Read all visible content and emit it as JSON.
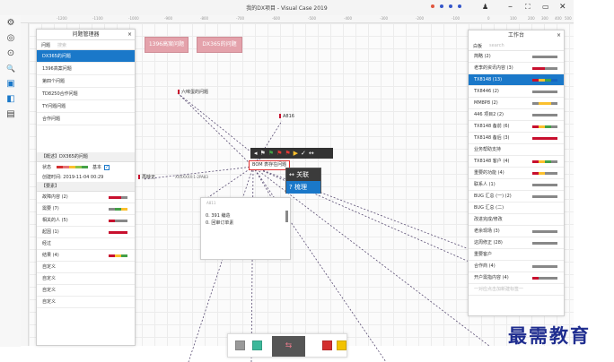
{
  "window": {
    "title": "我的DX项目 - Visual Case 2019",
    "status_dots": [
      "#e0563f",
      "#3556c9",
      "#3556c9",
      "#3556c9"
    ],
    "controls": {
      "user": "♟",
      "minimize": "–",
      "maximize": "⛶",
      "restore": "▭",
      "close": "✕"
    }
  },
  "left_toolbar": {
    "icons": [
      "gear-icon",
      "compass-icon",
      "target-icon",
      "search-icon",
      "layers-icon",
      "folder-icon",
      "chart-icon"
    ],
    "glyphs": [
      "⚙",
      "◎",
      "⊙",
      "🔍",
      "▣",
      "◧",
      "▤"
    ]
  },
  "ruler": {
    "ticks": [
      "-1200",
      "-1100",
      "-1000",
      "-900",
      "-800",
      "-700",
      "-600",
      "-500",
      "-400",
      "-300",
      "-200",
      "-100",
      "0",
      "100",
      "200",
      "300",
      "400",
      "500"
    ]
  },
  "problem_panel": {
    "title": "问题管理器",
    "close": "×",
    "tabs": [
      "问题",
      "搜索"
    ],
    "items": [
      "DX365的问题",
      "1396高案问题",
      "第四个问题",
      "TD8250合作问题",
      "TY问题问题",
      "合作问题"
    ],
    "selected_index": 0,
    "info_header": "【概述】DX365的问题",
    "status_label": "状态",
    "status_bars": [
      "#d32f2f",
      "#e57373",
      "#fbc02d",
      "#8bc34a",
      "#43a047"
    ],
    "basic_label": "基本",
    "created_label": "创建时间: 2019-11-04 00:29",
    "tags_header": "【要素】",
    "tags": [
      {
        "label": "故障内容 (2)",
        "bars": [
          "#c8102e",
          "#c8102e",
          "#888"
        ]
      },
      {
        "label": "需要 (7)",
        "bars": [
          "#888",
          "#43a047",
          "#fbc02d"
        ]
      },
      {
        "label": "相关的人 (5)",
        "bars": [
          "#c8102e",
          "#888",
          "#888"
        ]
      },
      {
        "label": "起因 (1)",
        "bars": [
          "#c8102e",
          "#c8102e",
          "#c8102e"
        ]
      },
      {
        "label": "经过",
        "bars": []
      },
      {
        "label": "结果 (4)",
        "bars": [
          "#c8102e",
          "#fbc02d",
          "#43a047"
        ]
      },
      {
        "label": "自定义",
        "bars": []
      },
      {
        "label": "自定义",
        "bars": []
      },
      {
        "label": "自定义",
        "bars": []
      },
      {
        "label": "自定义",
        "bars": []
      }
    ]
  },
  "canvas": {
    "chips": [
      "1396高案问题",
      "DX365的问题"
    ],
    "nodes": {
      "n1": "六味蛋的问题",
      "n2": "A816",
      "n3": "再映无",
      "n4": "XXXXXXX-1-2PA83",
      "n5": "BOM 表存在问题"
    },
    "node_toolbar": [
      "◂",
      "⚑",
      "⚑",
      "⚑",
      "⚑",
      "▶",
      "✓",
      "↔"
    ],
    "context_menu": [
      {
        "icon": "↔",
        "label": "关联"
      },
      {
        "icon": "?",
        "label": "梳理"
      }
    ],
    "context_selected": 1,
    "note": {
      "title": "A811",
      "lines": [
        "0. 391 编造",
        "0. 回审订单素"
      ]
    }
  },
  "workbench": {
    "title": "工作台",
    "close": "×",
    "tabs": [
      "白板",
      "search"
    ],
    "rows": [
      {
        "label": "简略 (2)",
        "bars": [
          "#888",
          "#888",
          "#888",
          "#888"
        ]
      },
      {
        "label": "老李的资讯内容 (3)",
        "bars": [
          "#c8102e",
          "#c8102e",
          "#888",
          "#888"
        ]
      },
      {
        "label": "TX8148 (13)",
        "bars": [
          "#c8102e",
          "#fbc02d",
          "#43a047",
          "#1565c0"
        ]
      },
      {
        "label": "TX8446 (2)",
        "bars": [
          "#888",
          "#888",
          "#888",
          "#888"
        ]
      },
      {
        "label": "MM8P8 (2)",
        "bars": [
          "#888",
          "#fbc02d",
          "#fbc02d",
          "#888"
        ]
      },
      {
        "label": "446 项目2 (2)",
        "bars": [
          "#888",
          "#888",
          "#888",
          "#888"
        ]
      },
      {
        "label": "TX8148 备前 (6)",
        "bars": [
          "#c8102e",
          "#fbc02d",
          "#43a047",
          "#888"
        ]
      },
      {
        "label": "TX8148 备后 (3)",
        "bars": [
          "#c8102e",
          "#c8102e",
          "#c8102e",
          "#c8102e"
        ]
      },
      {
        "label": "业务帮助支持",
        "bars": []
      },
      {
        "label": "TX8148 客户 (4)",
        "bars": [
          "#c8102e",
          "#fbc02d",
          "#43a047",
          "#888"
        ]
      },
      {
        "label": "重要的功能 (4)",
        "bars": [
          "#c8102e",
          "#fbc02d",
          "#888",
          "#888"
        ]
      },
      {
        "label": "联系人 (1)",
        "bars": [
          "#888",
          "#888",
          "#888",
          "#888"
        ]
      },
      {
        "label": "BUG 汇总 (一) (2)",
        "bars": [
          "#888",
          "#888",
          "#888",
          "#888"
        ]
      },
      {
        "label": "BUG 汇总 (二)",
        "bars": []
      },
      {
        "label": "改进完成/修改",
        "bars": []
      },
      {
        "label": "老余现场 (3)",
        "bars": [
          "#888",
          "#888",
          "#888",
          "#888"
        ]
      },
      {
        "label": "这周修正 (28)",
        "bars": [
          "#888",
          "#888",
          "#888",
          "#888"
        ]
      },
      {
        "label": "重要客户",
        "bars": []
      },
      {
        "label": "合作商 (4)",
        "bars": [
          "#888",
          "#888",
          "#888",
          "#888"
        ]
      },
      {
        "label": "开户需指内容 (4)",
        "bars": [
          "#c8102e",
          "#888",
          "#888",
          "#888"
        ]
      },
      {
        "label": "一对应点击加新建标签一",
        "bars": []
      }
    ],
    "selected_index": 2
  },
  "dock": {
    "left": [
      "#9a9a9a",
      "#3db89a"
    ],
    "center": "⇆",
    "right": [
      "#d32f2f",
      "#f2c200"
    ]
  },
  "watermark": "最需教育"
}
